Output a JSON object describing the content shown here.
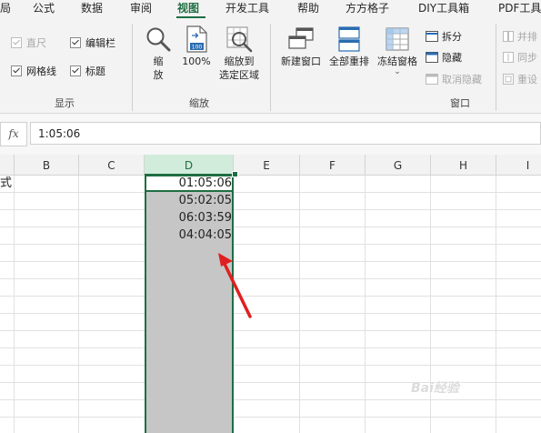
{
  "menu": {
    "tabs": [
      {
        "label": "局"
      },
      {
        "label": "公式"
      },
      {
        "label": "数据"
      },
      {
        "label": "审阅"
      },
      {
        "label": "视图",
        "active": true
      },
      {
        "label": "开发工具"
      },
      {
        "label": "帮助"
      },
      {
        "label": "方方格子"
      },
      {
        "label": "DIY工具箱"
      },
      {
        "label": "PDF工具"
      }
    ]
  },
  "ribbon": {
    "show_group": {
      "label": "显示",
      "ruler": "直尺",
      "formula_bar": "编辑栏",
      "gridlines": "网格线",
      "headings": "标题"
    },
    "zoom_group": {
      "label": "缩放",
      "zoom": "缩\n放",
      "zoom_100": "100%",
      "zoom_selection": "缩放到\n选定区域"
    },
    "window_group": {
      "label": "窗口",
      "new_window": "新建窗口",
      "arrange_all": "全部重排",
      "freeze_panes": "冻结窗格",
      "split": "拆分",
      "hide": "隐藏",
      "unhide": "取消隐藏",
      "side_by_side": "并排",
      "sync_scroll": "同步",
      "reset_position": "重设"
    }
  },
  "formula_bar": {
    "fx": "fx",
    "value": "1:05:06"
  },
  "grid": {
    "columns": [
      "B",
      "C",
      "D",
      "E",
      "F",
      "G",
      "H",
      "I"
    ],
    "selected_column": "D",
    "partial_a_cell": "式",
    "values": [
      "01:05:06",
      "05:02:05",
      "06:03:59",
      "04:04:05"
    ]
  },
  "watermark": "Bai经验",
  "colors": {
    "accent": "#1e6e43",
    "selection_fill": "#c6c6c6",
    "header_selected": "#d2ecdb",
    "arrow": "#e02020"
  }
}
